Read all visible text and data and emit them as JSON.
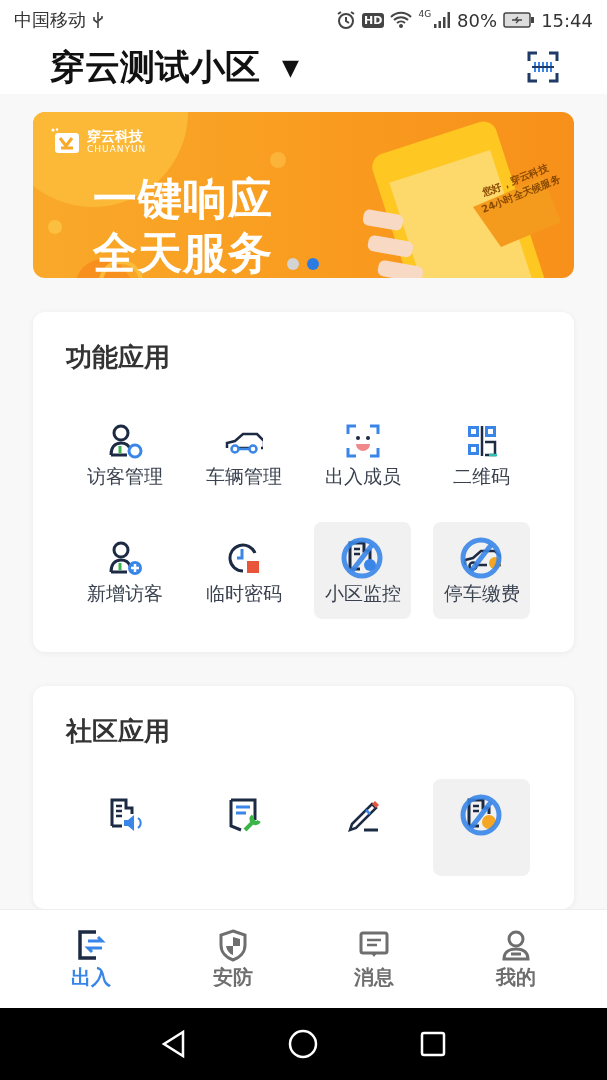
{
  "status_bar": {
    "carrier": "中国移动",
    "hd": "HD",
    "network": "4G",
    "battery": "80%",
    "time": "15:44"
  },
  "header": {
    "title": "穿云测试小区",
    "dropdown": "▼"
  },
  "banner": {
    "brand": "穿云科技",
    "brand_en": "CHUANYUN",
    "headline_1": "一键响应",
    "headline_2": "全天服务",
    "bubble_1": "您好，穿云科技",
    "bubble_2": "24小时全天候服务",
    "pages": [
      {
        "selected": false
      },
      {
        "selected": true
      }
    ]
  },
  "sections": [
    {
      "title": "功能应用",
      "items": [
        {
          "label": "访客管理",
          "disabled": false
        },
        {
          "label": "车辆管理",
          "disabled": false
        },
        {
          "label": "出入成员",
          "disabled": false
        },
        {
          "label": "二维码",
          "disabled": false
        },
        {
          "label": "新增访客",
          "disabled": false
        },
        {
          "label": "临时密码",
          "disabled": false
        },
        {
          "label": "小区监控",
          "disabled": true
        },
        {
          "label": "停车缴费",
          "disabled": true
        }
      ]
    },
    {
      "title": "社区应用",
      "items": [
        {
          "disabled": false
        },
        {
          "disabled": false
        },
        {
          "disabled": false
        },
        {
          "disabled": true
        }
      ]
    }
  ],
  "tabs": [
    {
      "label": "出入",
      "selected": true
    },
    {
      "label": "安防",
      "selected": false
    },
    {
      "label": "消息",
      "selected": false
    },
    {
      "label": "我的",
      "selected": false
    }
  ]
}
